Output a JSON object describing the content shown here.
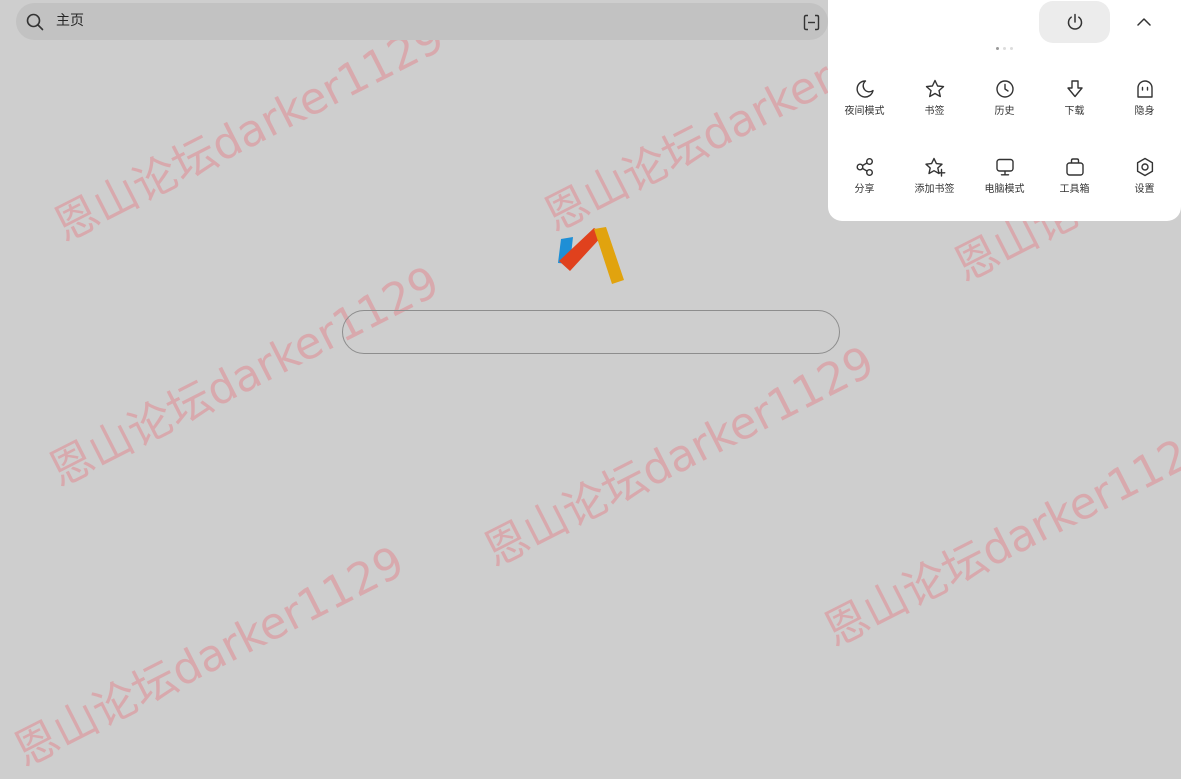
{
  "address_bar": {
    "text": "主页"
  },
  "home_search": {
    "value": "",
    "placeholder": ""
  },
  "menu": {
    "items": [
      {
        "label": "夜间模式",
        "icon": "moon-icon"
      },
      {
        "label": "书签",
        "icon": "star-icon"
      },
      {
        "label": "历史",
        "icon": "clock-icon"
      },
      {
        "label": "下载",
        "icon": "download-arrow-icon"
      },
      {
        "label": "隐身",
        "icon": "ghost-icon"
      },
      {
        "label": "分享",
        "icon": "share-icon"
      },
      {
        "label": "添加书签",
        "icon": "star-plus-icon"
      },
      {
        "label": "电脑模式",
        "icon": "monitor-icon"
      },
      {
        "label": "工具箱",
        "icon": "toolbox-icon"
      },
      {
        "label": "设置",
        "icon": "gear-icon"
      }
    ]
  },
  "watermark": {
    "text": "恩山论坛darker1129"
  },
  "colors": {
    "page_background": "#cecece",
    "address_bar": "#c2c2c2",
    "logo_blue": "#1e8fd6",
    "logo_red": "#e0411d",
    "logo_yellow": "#e1a30e",
    "watermark": "#e87880"
  }
}
